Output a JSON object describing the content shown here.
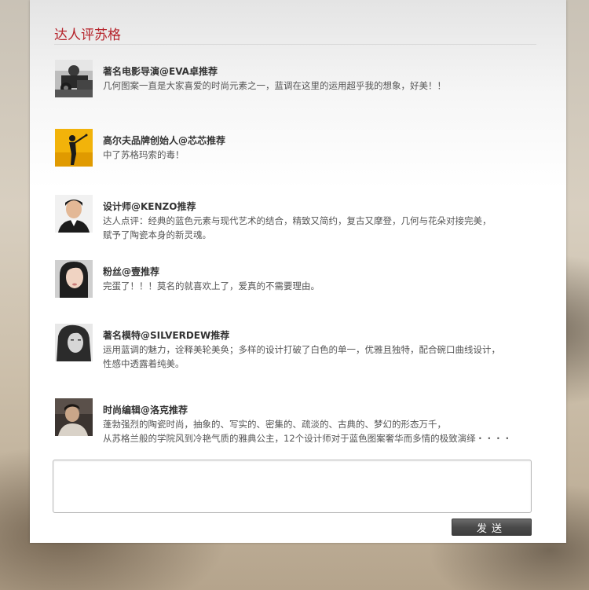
{
  "section_title": "达人评苏格",
  "reviews": [
    {
      "name": "著名电影导演@EVA卓推荐",
      "lines": [
        "几何图案一直是大家喜爱的时尚元素之一，蓝调在这里的运用超乎我的想象，好美！！"
      ],
      "avatar_icon": "film-director-camera-photo"
    },
    {
      "name": "高尔夫品牌创始人@芯芯推荐",
      "lines": [
        "中了苏格玛索的毒！"
      ],
      "avatar_icon": "golfer-silhouette-photo"
    },
    {
      "name": "设计师@KENZO推荐",
      "lines": [
        "达人点评：经典的蓝色元素与现代艺术的结合，精致又简约，复古又摩登，几何与花朵对接完美，",
        "赋予了陶瓷本身的新灵魂。"
      ],
      "avatar_icon": "designer-portrait-photo"
    },
    {
      "name": "粉丝@壹推荐",
      "lines": [
        "完蛋了！！！莫名的就喜欢上了，爱真的不需要理由。"
      ],
      "avatar_icon": "woman-portrait-photo"
    },
    {
      "name": "著名模特@SILVERDEW推荐",
      "lines": [
        "运用蓝调的魅力，诠释美轮美奂；多样的设计打破了白色的单一，优雅且独特，配合碗口曲线设计，",
        "性感中透露着纯美。"
      ],
      "avatar_icon": "model-bw-portrait-photo"
    },
    {
      "name": "时尚编辑@洛克推荐",
      "lines": [
        "蓬勃强烈的陶瓷时尚，抽象的、写实的、密集的、疏淡的、古典的、梦幻的形态万千，",
        "从苏格兰般的学院风到冷艳气质的雅典公主，12个设计师对于蓝色图案奢华而多情的极致演绎・・・・"
      ],
      "avatar_icon": "editor-portrait-photo"
    }
  ],
  "message_input": {
    "value": "",
    "placeholder": ""
  },
  "send_button_label": "发送",
  "colors": {
    "title": "#b5222a",
    "button": "#4a4a4a"
  }
}
